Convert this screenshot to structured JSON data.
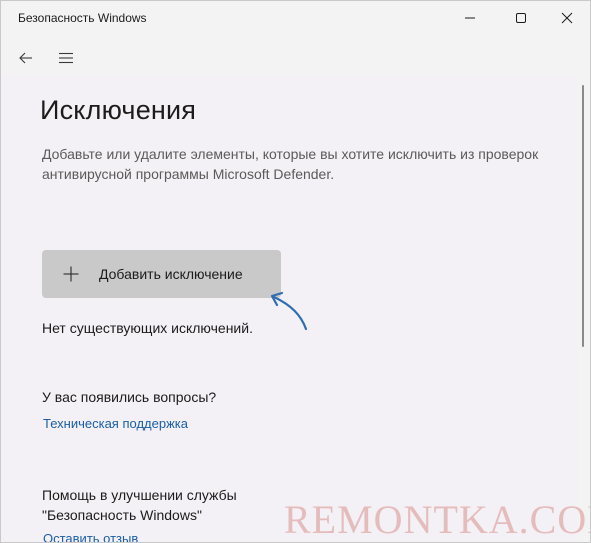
{
  "window": {
    "title": "Безопасность Windows"
  },
  "icons": {
    "minimize": "minimize-icon",
    "maximize": "maximize-icon",
    "close": "close-icon",
    "back": "back-arrow-icon",
    "menu": "hamburger-menu-icon",
    "add": "plus-icon"
  },
  "page": {
    "title": "Исключения",
    "description": "Добавьте или удалите элементы, которые вы хотите исключить из проверок антивирусной программы Microsoft Defender.",
    "add_button_label": "Добавить исключение",
    "no_exclusions_text": "Нет существующих исключений.",
    "questions_heading": "У вас появились вопросы?",
    "support_link": "Техническая поддержка",
    "improve_heading_line1": "Помощь в улучшении службы",
    "improve_heading_line2": "\"Безопасность Windows\"",
    "feedback_link": "Оставить отзыв"
  },
  "watermark": "REMONTKA.COM",
  "colors": {
    "background": "#f3f1f5",
    "button": "#c9c9c9",
    "link": "#1a5ea6",
    "arrow": "#2f6db0"
  }
}
